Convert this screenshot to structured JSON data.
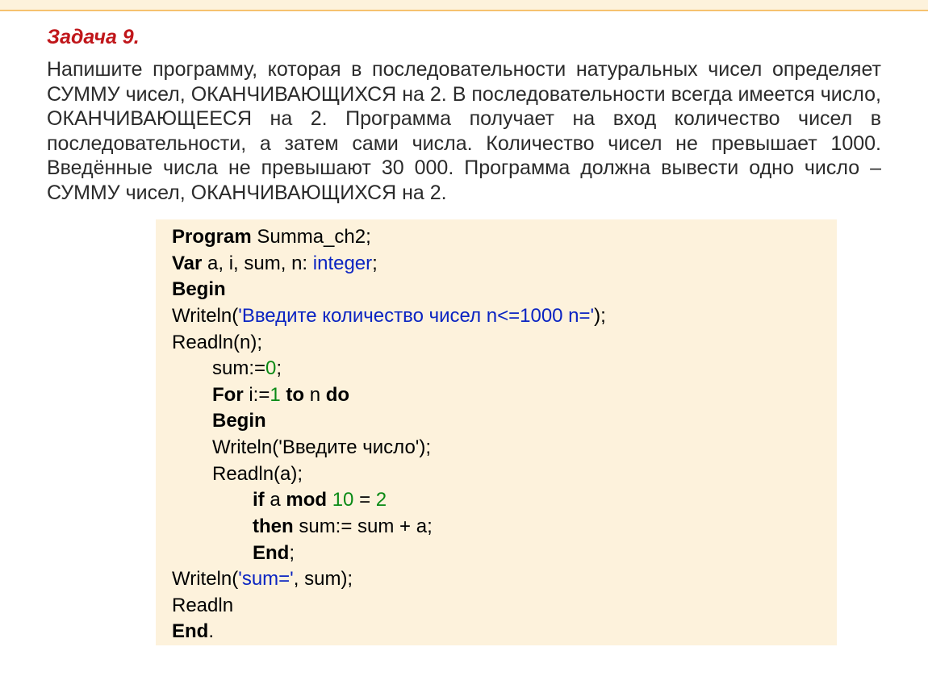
{
  "title": "Задача 9.",
  "body": "Напишите программу, которая в последовательности натуральных чисел определяет СУММУ чисел, ОКАНЧИВАЮЩИХСЯ на 2. В последовательности всегда имеется число, ОКАНЧИВАЮЩЕЕСЯ на 2. Программа получает на вход количество чисел в последовательности, а затем сами числа. Количество чисел не превышает 1000. Введённые числа не превышают 30 000. Программа должна вывести одно число – СУММУ чисел, ОКАНЧИВАЮЩИХСЯ на 2.",
  "code": {
    "l1_kw": "Program",
    "l1_rest": " Summa_ch2;",
    "l2_kw": "Var",
    "l2_mid": " a, i, sum, n: ",
    "l2_type": "integer",
    "l2_end": ";",
    "l3_kw": "Begin",
    "l4_pre": "Writeln(",
    "l4_str": "'Введите количество чисел n<=1000 n='",
    "l4_post": ");",
    "l5": "Readln(n);",
    "l6_pre": "sum:=",
    "l6_num": "0",
    "l6_post": ";",
    "l7_kw1": "For",
    "l7_mid1": " i:=",
    "l7_num": "1",
    "l7_mid2": " ",
    "l7_kw2": "to",
    "l7_mid3": " n ",
    "l7_kw3": "do",
    "l8_kw": "Begin",
    "l9": "Writeln('Введите число');",
    "l10": "Readln(a);",
    "l11_kw1": "if",
    "l11_mid1": " a ",
    "l11_kw2": "mod",
    "l11_mid2": " ",
    "l11_num1": "10",
    "l11_mid3": " = ",
    "l11_num2": "2",
    "l12_kw": "then",
    "l12_rest": " sum:= sum + a;",
    "l13_kw": "End",
    "l13_post": ";",
    "l14_pre": "Writeln(",
    "l14_str": "'sum='",
    "l14_post": ", sum);",
    "l15": "Readln",
    "l16_kw": "End",
    "l16_post": "."
  }
}
